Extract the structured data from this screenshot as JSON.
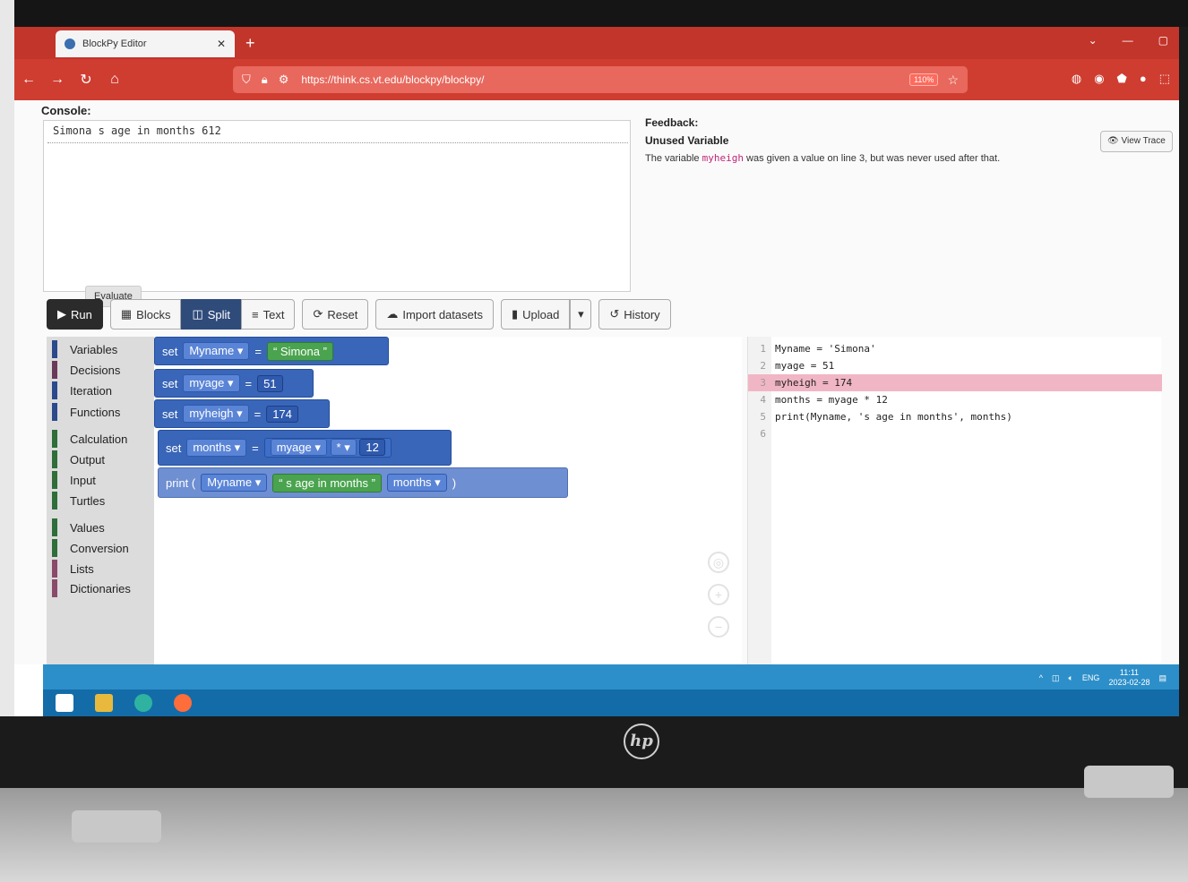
{
  "browser": {
    "tab_title": "BlockPy Editor",
    "url": "https://think.cs.vt.edu/blockpy/blockpy/",
    "zoom": "110%"
  },
  "console": {
    "label": "Console:",
    "output": "Simona s age in months 612",
    "evaluate_label": "Evaluate"
  },
  "feedback": {
    "label": "Feedback:",
    "title": "Unused Variable",
    "msg_prefix": "The variable ",
    "msg_var": "myheigh",
    "msg_suffix": " was given a value on line 3, but was never used after that.",
    "view_trace_label": "View Trace"
  },
  "toolbar": {
    "run": "Run",
    "blocks": "Blocks",
    "split": "Split",
    "text": "Text",
    "reset": "Reset",
    "import": "Import datasets",
    "upload": "Upload",
    "history": "History"
  },
  "toolbox": {
    "categories": [
      {
        "label": "Variables",
        "color": "#2b4a8c"
      },
      {
        "label": "Decisions",
        "color": "#6a3a5a"
      },
      {
        "label": "Iteration",
        "color": "#2b4a8c"
      },
      {
        "label": "Functions",
        "color": "#2b4a8c"
      },
      {
        "label": "Calculation",
        "color": "#2f6d3a"
      },
      {
        "label": "Output",
        "color": "#2f6d3a"
      },
      {
        "label": "Input",
        "color": "#2f6d3a"
      },
      {
        "label": "Turtles",
        "color": "#2f6d3a"
      },
      {
        "label": "Values",
        "color": "#2f6d3a"
      },
      {
        "label": "Conversion",
        "color": "#2f6d3a"
      },
      {
        "label": "Lists",
        "color": "#8a4a6a"
      },
      {
        "label": "Dictionaries",
        "color": "#8a4a6a"
      }
    ]
  },
  "blocks": {
    "set_kw": "set",
    "print_kw": "print (",
    "b1": {
      "var": "Myname",
      "value": "Simona"
    },
    "b2": {
      "var": "myage",
      "value": "51"
    },
    "b3": {
      "var": "myheigh",
      "value": "174"
    },
    "b4": {
      "var": "months",
      "left": "myage",
      "op": "*",
      "right": "12"
    },
    "b5": {
      "a": "Myname",
      "b": "s age in months",
      "c": "months"
    }
  },
  "code": {
    "lines": [
      {
        "n": "1",
        "text": "Myname = 'Simona'"
      },
      {
        "n": "2",
        "text": "myage = 51"
      },
      {
        "n": "3",
        "text": "myheigh = 174"
      },
      {
        "n": "4",
        "text": "months = myage * 12"
      },
      {
        "n": "5",
        "text": "print(Myname, 's age in months', months)"
      },
      {
        "n": "6",
        "text": ""
      }
    ]
  },
  "taskbar": {
    "lang": "ENG",
    "time": "11:11",
    "date": "2023-02-28"
  },
  "laptop": {
    "brand": "hp"
  }
}
